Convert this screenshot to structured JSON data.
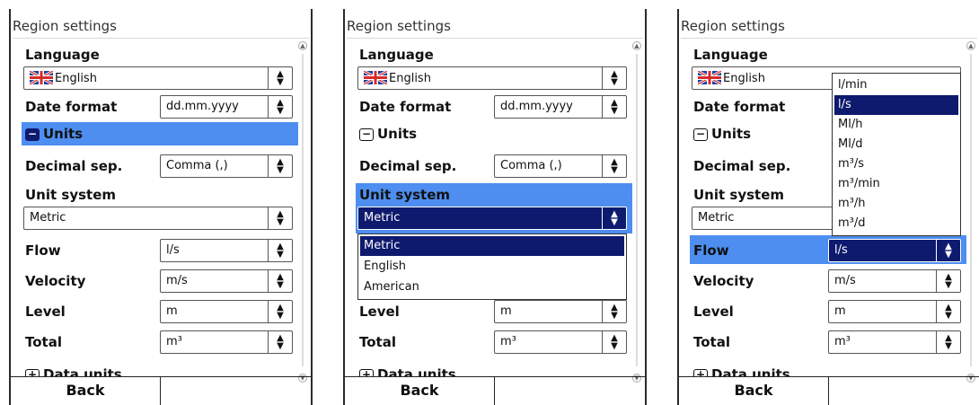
{
  "screens": [
    {
      "title": "Region settings",
      "language_label": "Language",
      "language_value": "English",
      "date_format_label": "Date format",
      "date_format_value": "dd.mm.yyyy",
      "units_section": "Units",
      "decimal_label": "Decimal sep.",
      "decimal_value": "Comma (,)",
      "unit_system_label": "Unit system",
      "unit_system_value": "Metric",
      "flow_label": "Flow",
      "flow_value": "l/s",
      "velocity_label": "Velocity",
      "velocity_value": "m/s",
      "level_label": "Level",
      "level_value": "m",
      "total_label": "Total",
      "total_value": "m³",
      "data_units_section": "Data units",
      "back_label": "Back"
    },
    {
      "title": "Region settings",
      "language_label": "Language",
      "language_value": "English",
      "date_format_label": "Date format",
      "date_format_value": "dd.mm.yyyy",
      "units_section": "Units",
      "decimal_label": "Decimal sep.",
      "decimal_value": "Comma (,)",
      "unit_system_label": "Unit system",
      "unit_system_value": "Metric",
      "unit_system_options": [
        "Metric",
        "English",
        "American"
      ],
      "level_label": "Level",
      "level_value": "m",
      "total_label": "Total",
      "total_value": "m³",
      "data_units_section": "Data units",
      "back_label": "Back"
    },
    {
      "title": "Region settings",
      "language_label": "Language",
      "language_value": "English",
      "date_format_label": "Date format",
      "units_section": "Units",
      "decimal_label": "Decimal sep.",
      "unit_system_label": "Unit system",
      "unit_system_value": "Metric",
      "flow_label": "Flow",
      "flow_value": "l/s",
      "flow_options": [
        "l/min",
        "l/s",
        "Ml/h",
        "Ml/d",
        "m³/s",
        "m³/min",
        "m³/h",
        "m³/d"
      ],
      "velocity_label": "Velocity",
      "velocity_value": "m/s",
      "level_label": "Level",
      "level_value": "m",
      "total_label": "Total",
      "total_value": "m³",
      "data_units_section": "Data units",
      "back_label": "Back"
    }
  ],
  "colors": {
    "highlight": "#4d8ef0",
    "selected": "#0e1a6e"
  },
  "icons": {
    "flag": "uk-flag-icon",
    "spinner": "updown-arrow-icon",
    "collapse": "minus-box-icon",
    "expand": "plus-box-icon"
  }
}
